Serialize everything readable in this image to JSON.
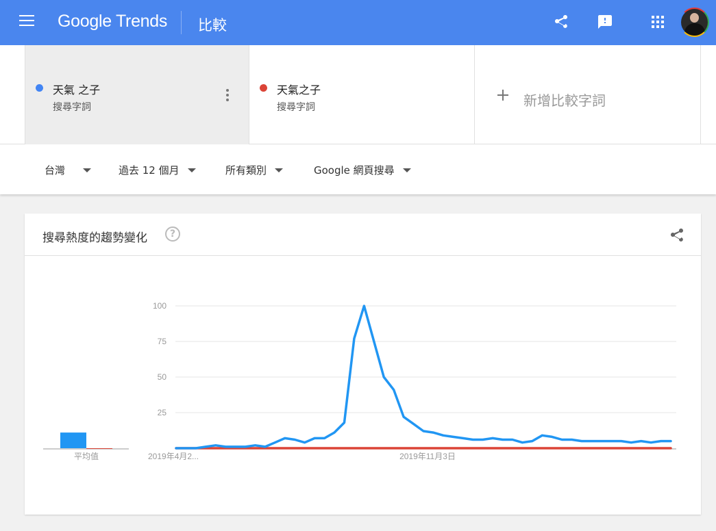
{
  "app": {
    "logo": "Google Trends",
    "page_title": "比較",
    "icons": [
      "menu-icon",
      "share-icon",
      "feedback-icon",
      "apps-icon",
      "avatar"
    ]
  },
  "terms": [
    {
      "name": "天氣 之子",
      "subtitle": "搜尋字詞",
      "color": "#4285f4"
    },
    {
      "name": "天氣之子",
      "subtitle": "搜尋字詞",
      "color": "#db4437"
    }
  ],
  "add_term": {
    "label": "新增比較字詞"
  },
  "filters": {
    "region": "台灣",
    "time": "過去 12 個月",
    "category": "所有類別",
    "search_type": "Google 網頁搜尋"
  },
  "card": {
    "title": "搜尋熱度的趨勢變化",
    "help": "?"
  },
  "chart_data": {
    "type": "line",
    "x_tick_labels": [
      "2019年4月2...",
      "2019年11月3日"
    ],
    "ylim": [
      0,
      100
    ],
    "yticks": [
      25,
      50,
      75,
      100
    ],
    "grid": true,
    "average_label": "平均值",
    "averages": [
      11,
      0
    ],
    "series": [
      {
        "name": "天氣 之子",
        "color": "#2196f3",
        "values": [
          0,
          0,
          0,
          1,
          2,
          1,
          1,
          1,
          2,
          1,
          4,
          7,
          6,
          4,
          7,
          7,
          11,
          18,
          77,
          100,
          75,
          50,
          41,
          22,
          17,
          12,
          11,
          9,
          8,
          7,
          6,
          6,
          7,
          6,
          6,
          4,
          5,
          9,
          8,
          6,
          6,
          5,
          5,
          5,
          5,
          5,
          4,
          5,
          4,
          5,
          5
        ]
      },
      {
        "name": "天氣之子",
        "color": "#db4437",
        "values": [
          0,
          0,
          0,
          0,
          0,
          0,
          0,
          0,
          0,
          0,
          0,
          0,
          0,
          0,
          0,
          0,
          0,
          0,
          0,
          0,
          0,
          0,
          0,
          0,
          0,
          0,
          0,
          0,
          0,
          0,
          0,
          0,
          0,
          0,
          0,
          0,
          0,
          0,
          0,
          0,
          0,
          0,
          0,
          0,
          0,
          0,
          0,
          0,
          0,
          0,
          0
        ]
      }
    ]
  }
}
